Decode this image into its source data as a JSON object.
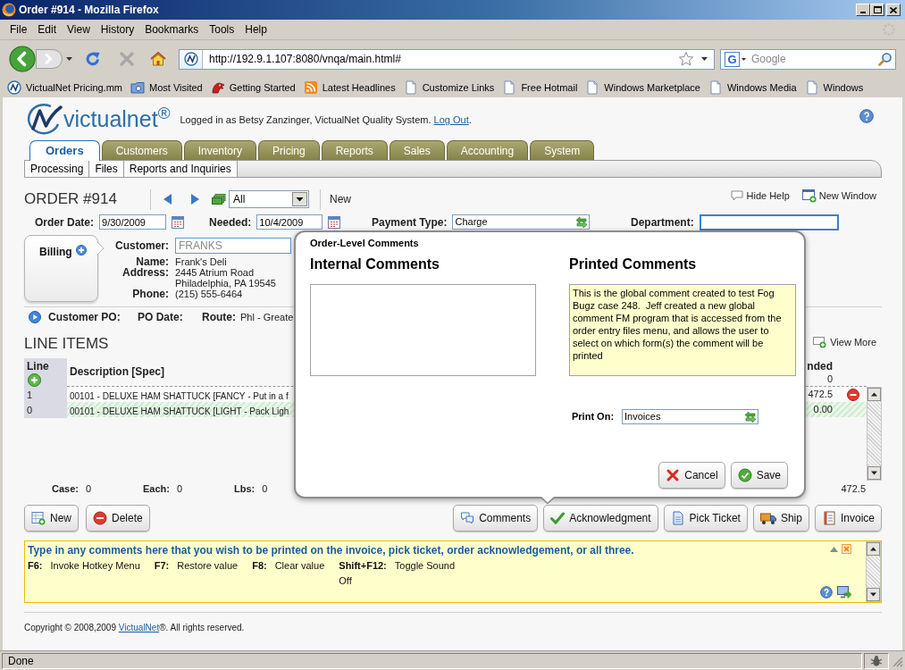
{
  "window": {
    "title": "Order #914 - Mozilla Firefox"
  },
  "menu": [
    "File",
    "Edit",
    "View",
    "History",
    "Bookmarks",
    "Tools",
    "Help"
  ],
  "address_bar": {
    "url": "http://192.9.1.107:8080/vnqa/main.html#"
  },
  "search": {
    "engine": "G",
    "placeholder": "Google"
  },
  "bookmarks": [
    {
      "label": "VictualNet Pricing.mm",
      "kind": "site"
    },
    {
      "label": "Most Visited",
      "kind": "smart"
    },
    {
      "label": "Getting Started",
      "kind": "starter"
    },
    {
      "label": "Latest Headlines",
      "kind": "feed"
    },
    {
      "label": "Customize Links",
      "kind": "page"
    },
    {
      "label": "Free Hotmail",
      "kind": "page"
    },
    {
      "label": "Windows Marketplace",
      "kind": "page"
    },
    {
      "label": "Windows Media",
      "kind": "page"
    },
    {
      "label": "Windows",
      "kind": "page"
    }
  ],
  "header": {
    "logo": "victualnet$^{®}$",
    "login": "Logged in as Betsy Zanzinger, VictualNet Quality System. ",
    "logout": "Log Out",
    "logout_end": "."
  },
  "tabs": [
    {
      "label": "Orders",
      "selected": true
    },
    {
      "label": "Customers",
      "selected": false
    },
    {
      "label": "Inventory",
      "selected": false
    },
    {
      "label": "Pricing",
      "selected": false
    },
    {
      "label": "Reports",
      "selected": false
    },
    {
      "label": "Sales",
      "selected": false
    },
    {
      "label": "Accounting",
      "selected": false
    },
    {
      "label": "System",
      "selected": false
    }
  ],
  "subtabs": [
    "Processing",
    "Files",
    "Reports and Inquiries"
  ],
  "order": {
    "title": "ORDER #914",
    "filter": "All",
    "new": "New",
    "hide_help": "Hide Help",
    "new_window": "New Window"
  },
  "fields": [
    {
      "label": "Order Date:",
      "value": "9/30/2009",
      "kind": "date"
    },
    {
      "label": "Needed:",
      "value": "10/4/2009",
      "kind": "date"
    },
    {
      "label": "Payment Type:",
      "value": "Charge",
      "kind": "lookup"
    },
    {
      "label": "Department:",
      "kind": "text",
      "focused": true
    }
  ],
  "billing": {
    "label": "Billing",
    "customer_label": "Customer:",
    "customer": "FRANKS",
    "details": [
      {
        "label": "Name:",
        "lines": [
          "Frank's Deli"
        ]
      },
      {
        "label": "Address:",
        "lines": [
          "2445 Atrium Road",
          "Philadelphia, PA 19545"
        ]
      },
      {
        "label": "Phone:",
        "lines": [
          "(215) 555-6464"
        ]
      }
    ]
  },
  "po_row": [
    {
      "label": "Customer PO:"
    },
    {
      "label": "PO Date:"
    },
    {
      "label": "Route:",
      "value": "Phl - Greate"
    }
  ],
  "line_items": {
    "title": "LINE ITEMS",
    "view_more": "View More",
    "columns": [
      "Line",
      "Description [Spec]",
      "nded"
    ],
    "header_total": "0",
    "rows": [
      {
        "line": "1",
        "description": "00101 - DELUXE HAM SHATTUCK [FANCY - Put in a f",
        "extended": "472.5",
        "selected": false,
        "deletable": true
      },
      {
        "line": "0",
        "description": "00101 - DELUXE HAM SHATTUCK [LIGHT - Pack Ligh",
        "extended": "0.00",
        "selected": true,
        "deletable": false
      }
    ]
  },
  "totals": [
    {
      "label": "Case:",
      "value": "0"
    },
    {
      "label": "Each:",
      "value": "0"
    },
    {
      "label": "Lbs:",
      "value": "0"
    }
  ],
  "grand_total": "472.5",
  "actions_left": [
    {
      "label": "New",
      "kind": "new"
    },
    {
      "label": "Delete",
      "kind": "delete"
    }
  ],
  "actions_right": [
    {
      "label": "Comments",
      "kind": "comments"
    },
    {
      "label": "Acknowledgment",
      "kind": "acknowledgment"
    },
    {
      "label": "Pick Ticket",
      "kind": "pick_ticket"
    },
    {
      "label": "Ship",
      "kind": "ship"
    },
    {
      "label": "Invoice",
      "kind": "invoice"
    }
  ],
  "help": {
    "message": "Type in any comments here that you wish to be printed on the invoice, pick ticket, order acknowledgement, or all three.",
    "hotkeys": [
      {
        "key": "F6:",
        "action": "Invoke Hotkey Menu"
      },
      {
        "key": "F7:",
        "action": "Restore value"
      },
      {
        "key": "F8:",
        "action": "Clear value"
      },
      {
        "key": "Shift+F12:",
        "action": "Toggle Sound",
        "note": "Off"
      }
    ]
  },
  "footer": {
    "before": "Copyright © 2008,2009 ",
    "link": "VictualNet",
    "after": "®. All rights reserved."
  },
  "status_bar": {
    "text": "Done"
  },
  "comments_dialog": {
    "title": "Order-Level Comments",
    "internal": {
      "heading": "Internal Comments"
    },
    "printed": {
      "heading": "Printed Comments",
      "value": "This is the global comment created to test Fog Bugz case 248.  Jeff created a new global comment FM program that is accessed from the order entry files menu, and allows the user to select on which form(s) the comment will be printed"
    },
    "print_on": {
      "label": "Print On:",
      "value": "Invoices"
    },
    "buttons": [
      {
        "label": "Cancel",
        "kind": "cancel"
      },
      {
        "label": "Save",
        "kind": "save"
      }
    ]
  }
}
